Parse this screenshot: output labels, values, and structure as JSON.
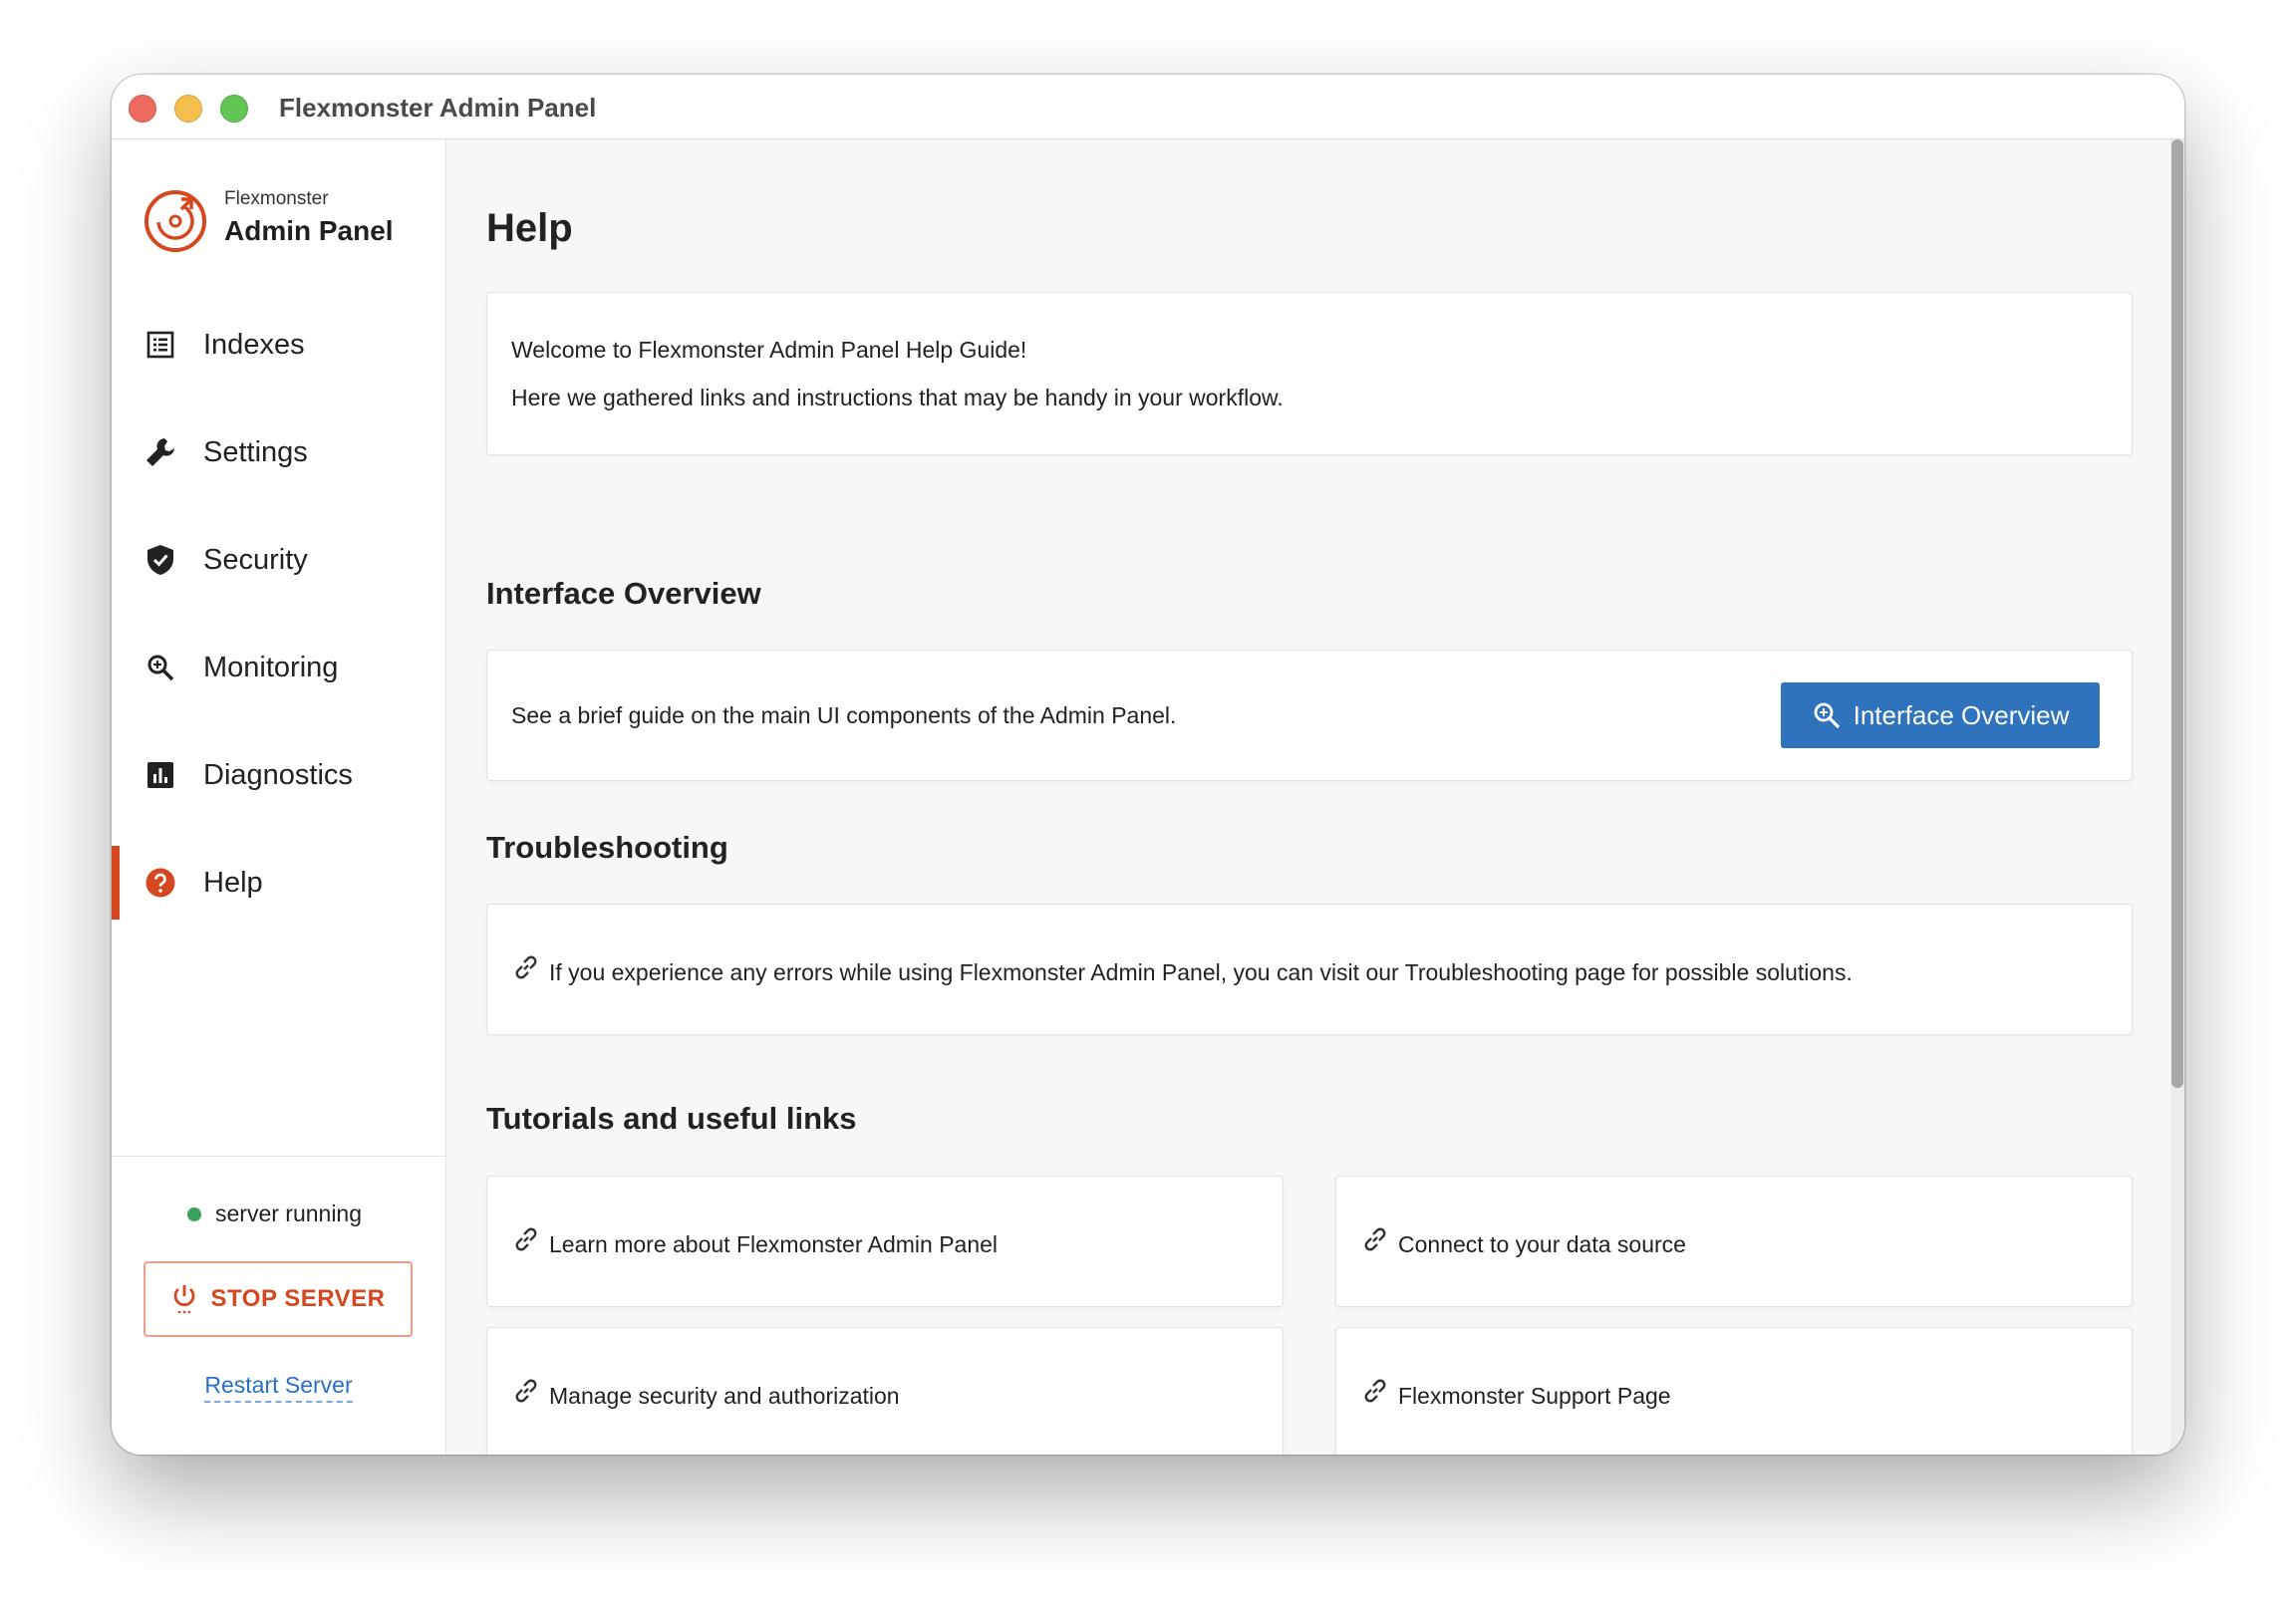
{
  "window": {
    "title": "Flexmonster Admin Panel"
  },
  "brand": {
    "small": "Flexmonster",
    "big": "Admin Panel",
    "accent": "#d5471f"
  },
  "sidebar": {
    "items": [
      {
        "label": "Indexes",
        "icon": "list-icon"
      },
      {
        "label": "Settings",
        "icon": "wrench-icon"
      },
      {
        "label": "Security",
        "icon": "shield-icon"
      },
      {
        "label": "Monitoring",
        "icon": "magnifier-icon"
      },
      {
        "label": "Diagnostics",
        "icon": "bar-chart-icon"
      },
      {
        "label": "Help",
        "icon": "help-icon",
        "active": true
      }
    ],
    "status": "server running",
    "stop_label": "STOP SERVER",
    "restart_label": "Restart Server"
  },
  "main": {
    "title": "Help",
    "welcome": {
      "line1": "Welcome to Flexmonster Admin Panel Help Guide!",
      "line2": "Here we gathered links and instructions that may be handy in your workflow."
    },
    "overview": {
      "heading": "Interface Overview",
      "text": "See a brief guide on the main UI components of the Admin Panel.",
      "button_label": "Interface Overview",
      "button_color": "#2f73bd"
    },
    "troubleshooting": {
      "heading": "Troubleshooting",
      "text": "If you experience any errors while using Flexmonster Admin Panel, you can visit our Troubleshooting page for possible solutions."
    },
    "tutorials": {
      "heading": "Tutorials and useful links",
      "links": [
        "Learn more about Flexmonster Admin Panel",
        "Connect to your data source",
        "Manage security and authorization",
        "Flexmonster Support Page"
      ]
    }
  }
}
